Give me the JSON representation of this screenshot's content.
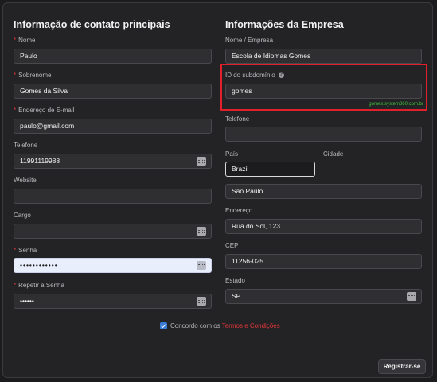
{
  "contact": {
    "title": "Informação de contato principais",
    "fields": [
      {
        "label": "Nome",
        "value": "Paulo",
        "required": true
      },
      {
        "label": "Sobrenome",
        "value": "Gomes da Silva",
        "required": true
      },
      {
        "label": "Endereço de E-mail",
        "value": "paulo@gmail.com",
        "required": true
      },
      {
        "label": "Telefone",
        "value": "11991119988",
        "required": false
      },
      {
        "label": "Website",
        "value": "",
        "required": false
      },
      {
        "label": "Cargo",
        "value": "",
        "required": false
      },
      {
        "label": "Senha",
        "value": "••••••••••••",
        "required": true
      },
      {
        "label": "Repetir a Senha",
        "value": "••••••",
        "required": true
      }
    ]
  },
  "company": {
    "title": "Informações da Empresa",
    "name_label": "Nome / Empresa",
    "name_value": "Escola de Idiomas Gomes",
    "subdomain_label": "ID do subdomínio",
    "subdomain_value": "gomes",
    "subdomain_hint": "gomes.system360.com.br",
    "phone_label": "Telefone",
    "phone_value": "",
    "country_label": "País",
    "city_label": "Cidade",
    "country_value": "Brazil",
    "city_value": "São Paulo",
    "address_label": "Endereço",
    "address_value": "Rua do Sol, 123",
    "cep_label": "CEP",
    "cep_value": "11256-025",
    "state_label": "Estado",
    "state_value": "SP"
  },
  "terms": {
    "prefix": "Concordo com os",
    "link": "Termos e Condições"
  },
  "submit_label": "Registrar-se",
  "required_marker": "*",
  "help_glyph": "?"
}
